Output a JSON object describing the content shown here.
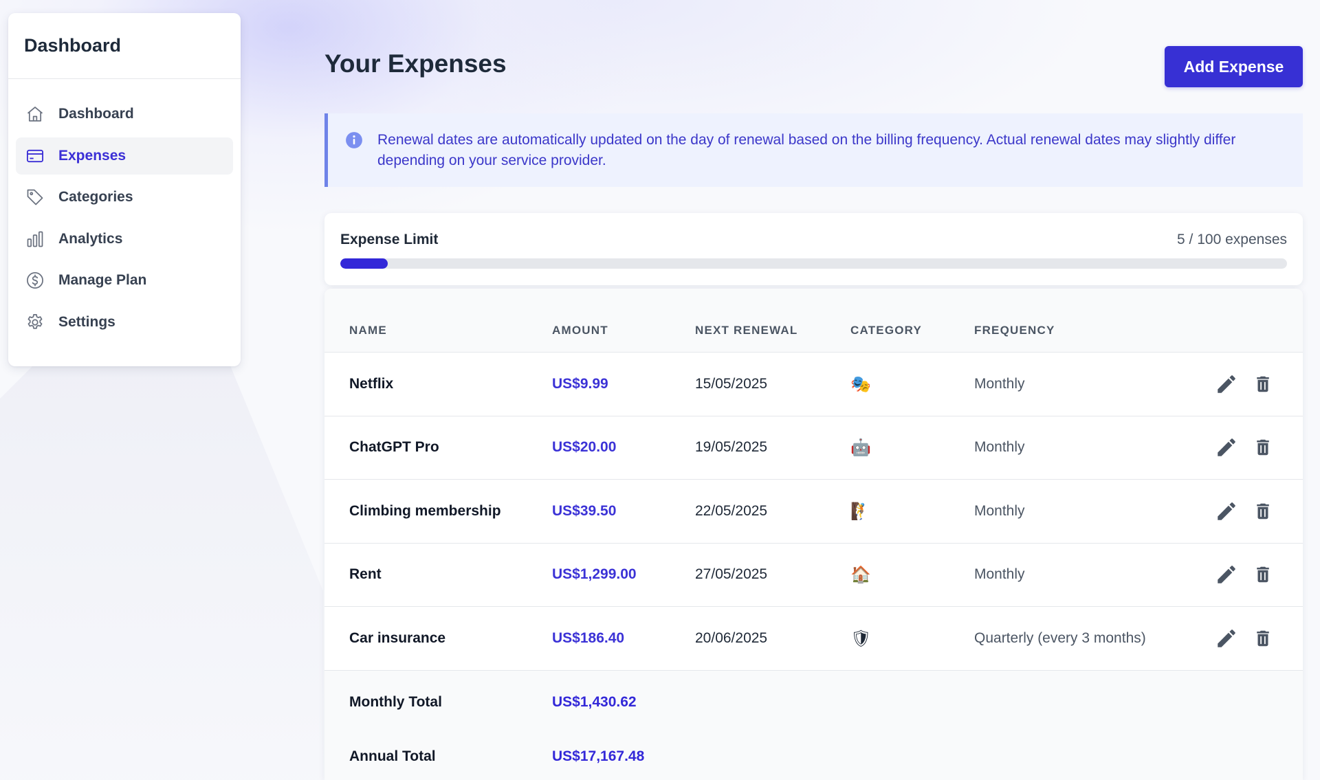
{
  "sidebar": {
    "title": "Dashboard",
    "items": [
      {
        "label": "Dashboard",
        "icon": "home-icon"
      },
      {
        "label": "Expenses",
        "icon": "credit-card-icon",
        "active": true
      },
      {
        "label": "Categories",
        "icon": "tag-icon"
      },
      {
        "label": "Analytics",
        "icon": "bar-chart-icon"
      },
      {
        "label": "Manage Plan",
        "icon": "dollar-circle-icon"
      },
      {
        "label": "Settings",
        "icon": "gear-icon"
      }
    ]
  },
  "header": {
    "title": "Your Expenses",
    "add_button_label": "Add Expense"
  },
  "info_banner": {
    "icon": "info-icon",
    "text": "Renewal dates are automatically updated on the day of renewal based on the billing frequency. Actual renewal dates may slightly differ depending on your service provider."
  },
  "limit": {
    "label": "Expense Limit",
    "count_text": "5 / 100 expenses",
    "used": 5,
    "max": 100
  },
  "table": {
    "headers": {
      "name": "NAME",
      "amount": "AMOUNT",
      "next_renewal": "NEXT RENEWAL",
      "category": "CATEGORY",
      "frequency": "FREQUENCY"
    },
    "rows": [
      {
        "name": "Netflix",
        "amount": "US$9.99",
        "next_renewal": "15/05/2025",
        "category_emoji": "🎭",
        "frequency": "Monthly"
      },
      {
        "name": "ChatGPT Pro",
        "amount": "US$20.00",
        "next_renewal": "19/05/2025",
        "category_emoji": "🤖",
        "frequency": "Monthly"
      },
      {
        "name": "Climbing membership",
        "amount": "US$39.50",
        "next_renewal": "22/05/2025",
        "category_emoji": "🧗",
        "frequency": "Monthly"
      },
      {
        "name": "Rent",
        "amount": "US$1,299.00",
        "next_renewal": "27/05/2025",
        "category_emoji": "🏠",
        "frequency": "Monthly"
      },
      {
        "name": "Car insurance",
        "amount": "US$186.40",
        "next_renewal": "20/06/2025",
        "category_emoji": "🛡",
        "frequency": "Quarterly (every 3 months)"
      }
    ],
    "totals": {
      "monthly_label": "Monthly Total",
      "monthly_value": "US$1,430.62",
      "annual_label": "Annual Total",
      "annual_value": "US$17,167.48"
    }
  },
  "colors": {
    "accent": "#3730d4",
    "amount_text": "#3b32d6",
    "info_background": "#eef2fe",
    "info_border": "#6f83e8"
  }
}
